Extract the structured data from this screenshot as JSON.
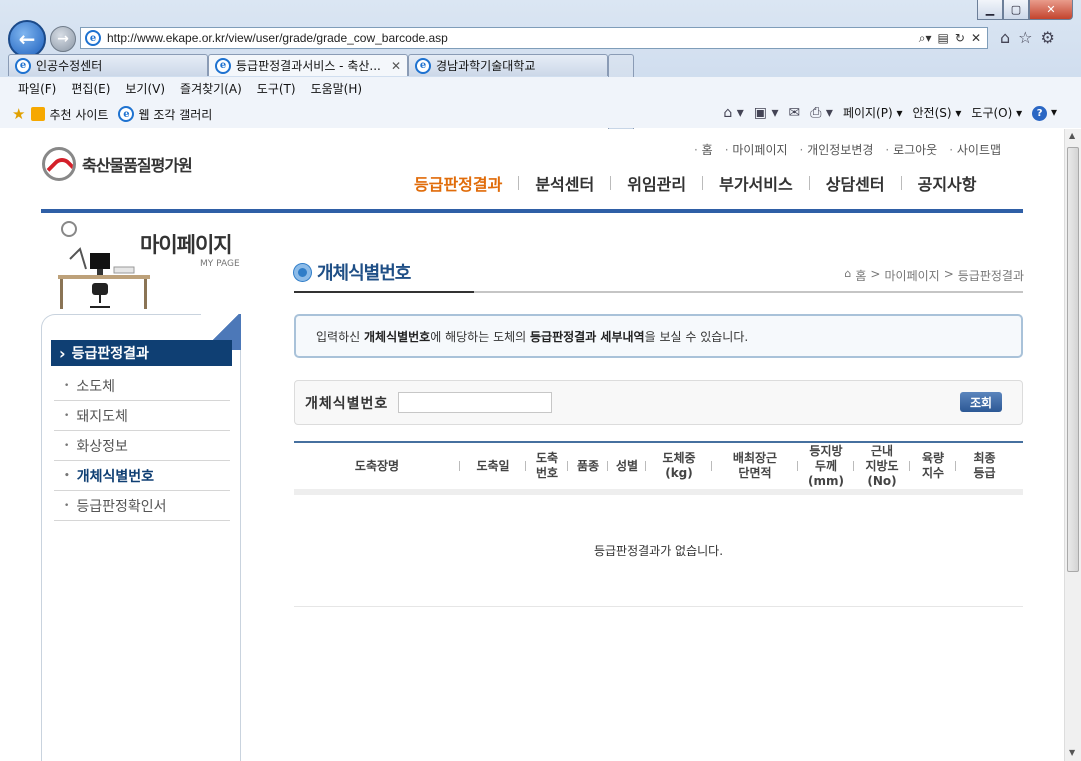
{
  "browser": {
    "url": "http://www.ekape.or.kr/view/user/grade/grade_cow_barcode.asp",
    "tabs": [
      {
        "label": "인공수정센터",
        "active": false
      },
      {
        "label": "등급판정결과서비스 - 축산...",
        "active": true
      },
      {
        "label": "경남과학기술대학교",
        "active": false
      }
    ],
    "menu": [
      "파일(F)",
      "편집(E)",
      "보기(V)",
      "즐겨찾기(A)",
      "도구(T)",
      "도움말(H)"
    ],
    "favorites": [
      "추천 사이트",
      "웹 조각 갤러리"
    ],
    "commands": [
      "페이지(P)",
      "안전(S)",
      "도구(O)"
    ]
  },
  "site": {
    "name": "축산물품질평가원",
    "util_links": [
      "홈",
      "마이페이지",
      "개인정보변경",
      "로그아웃",
      "사이트맵"
    ],
    "gnb": [
      "등급판정결과",
      "분석센터",
      "위임관리",
      "부가서비스",
      "상담센터",
      "공지사항"
    ]
  },
  "sidebar": {
    "title": "마이페이지",
    "subtitle": "MY PAGE",
    "section": "등급판정결과",
    "items": [
      "소도체",
      "돼지도체",
      "화상정보",
      "개체식별번호",
      "등급판정확인서"
    ],
    "active_index": 3
  },
  "main": {
    "title": "개체식별번호",
    "breadcrumb": [
      "홈",
      "마이페이지",
      "등급판정결과"
    ],
    "info": {
      "p1": "입력하신 ",
      "b1": "개체식별번호",
      "p2": "에 해당하는 도체의 ",
      "b2": "등급판정결과 세부내역",
      "p3": "을 보실 수 있습니다."
    },
    "search_label": "개체식별번호",
    "search_value": "",
    "search_button": "조회",
    "columns": [
      "도축장명",
      "도축일",
      "도축\n번호",
      "품종",
      "성별",
      "도체중\n(kg)",
      "배최장근\n단면적",
      "등지방\n두께\n(mm)",
      "근내\n지방도\n(No)",
      "육량\n지수",
      "최종\n등급"
    ],
    "empty_message": "등급판정결과가 없습니다."
  },
  "colors": {
    "accent": "#e06c0a",
    "navy": "#0f3f73",
    "rule": "#2f5fa6"
  }
}
